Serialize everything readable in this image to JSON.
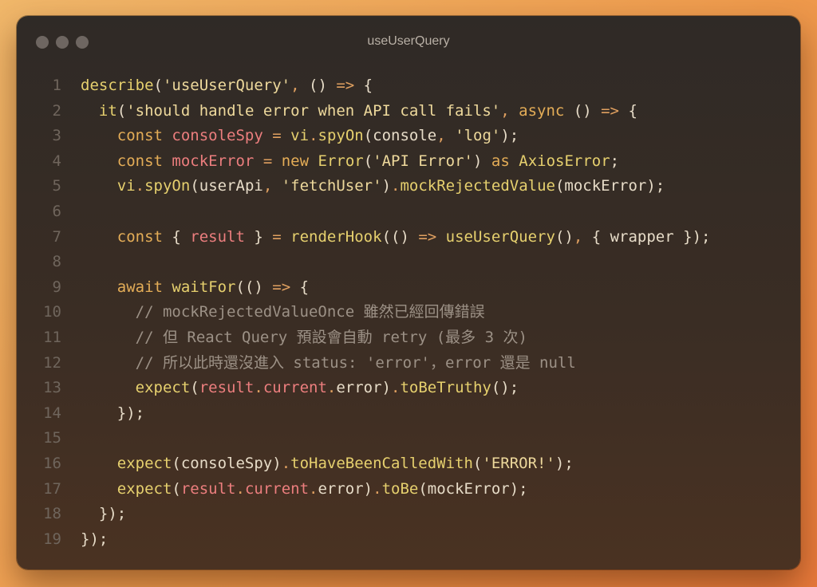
{
  "window": {
    "title": "useUserQuery"
  },
  "colors": {
    "keyword": "#e4ad57",
    "function": "#e6d06e",
    "string": "#eed99c",
    "variable": "#ec7e7e",
    "comment": "#9c9186",
    "plain": "#e7dcc8",
    "line_number": "#6f655c"
  },
  "code": {
    "lines": [
      {
        "n": "1",
        "tokens": [
          {
            "t": "fn",
            "v": "describe"
          },
          {
            "t": "pl",
            "v": "("
          },
          {
            "t": "str",
            "v": "'useUserQuery'"
          },
          {
            "t": "op",
            "v": ","
          },
          {
            "t": "pl",
            "v": " () "
          },
          {
            "t": "op",
            "v": "=>"
          },
          {
            "t": "pl",
            "v": " {"
          }
        ]
      },
      {
        "n": "2",
        "tokens": [
          {
            "t": "pl",
            "v": "  "
          },
          {
            "t": "fn",
            "v": "it"
          },
          {
            "t": "pl",
            "v": "("
          },
          {
            "t": "str",
            "v": "'should handle error when API call fails'"
          },
          {
            "t": "op",
            "v": ","
          },
          {
            "t": "pl",
            "v": " "
          },
          {
            "t": "kw",
            "v": "async"
          },
          {
            "t": "pl",
            "v": " () "
          },
          {
            "t": "op",
            "v": "=>"
          },
          {
            "t": "pl",
            "v": " {"
          }
        ]
      },
      {
        "n": "3",
        "tokens": [
          {
            "t": "pl",
            "v": "    "
          },
          {
            "t": "kw",
            "v": "const"
          },
          {
            "t": "pl",
            "v": " "
          },
          {
            "t": "var",
            "v": "consoleSpy"
          },
          {
            "t": "pl",
            "v": " "
          },
          {
            "t": "op",
            "v": "="
          },
          {
            "t": "pl",
            "v": " "
          },
          {
            "t": "fn",
            "v": "vi"
          },
          {
            "t": "op",
            "v": "."
          },
          {
            "t": "fn",
            "v": "spyOn"
          },
          {
            "t": "pl",
            "v": "(console"
          },
          {
            "t": "op",
            "v": ","
          },
          {
            "t": "pl",
            "v": " "
          },
          {
            "t": "str",
            "v": "'log'"
          },
          {
            "t": "pl",
            "v": ");"
          }
        ]
      },
      {
        "n": "4",
        "tokens": [
          {
            "t": "pl",
            "v": "    "
          },
          {
            "t": "kw",
            "v": "const"
          },
          {
            "t": "pl",
            "v": " "
          },
          {
            "t": "var",
            "v": "mockError"
          },
          {
            "t": "pl",
            "v": " "
          },
          {
            "t": "op",
            "v": "="
          },
          {
            "t": "pl",
            "v": " "
          },
          {
            "t": "kw",
            "v": "new"
          },
          {
            "t": "pl",
            "v": " "
          },
          {
            "t": "fn",
            "v": "Error"
          },
          {
            "t": "pl",
            "v": "("
          },
          {
            "t": "str",
            "v": "'API Error'"
          },
          {
            "t": "pl",
            "v": ") "
          },
          {
            "t": "kw",
            "v": "as"
          },
          {
            "t": "pl",
            "v": " "
          },
          {
            "t": "fn",
            "v": "AxiosError"
          },
          {
            "t": "pl",
            "v": ";"
          }
        ]
      },
      {
        "n": "5",
        "tokens": [
          {
            "t": "pl",
            "v": "    "
          },
          {
            "t": "fn",
            "v": "vi"
          },
          {
            "t": "op",
            "v": "."
          },
          {
            "t": "fn",
            "v": "spyOn"
          },
          {
            "t": "pl",
            "v": "(userApi"
          },
          {
            "t": "op",
            "v": ","
          },
          {
            "t": "pl",
            "v": " "
          },
          {
            "t": "str",
            "v": "'fetchUser'"
          },
          {
            "t": "pl",
            "v": ")"
          },
          {
            "t": "op",
            "v": "."
          },
          {
            "t": "fn",
            "v": "mockRejectedValue"
          },
          {
            "t": "pl",
            "v": "(mockError);"
          }
        ]
      },
      {
        "n": "6",
        "tokens": []
      },
      {
        "n": "7",
        "tokens": [
          {
            "t": "pl",
            "v": "    "
          },
          {
            "t": "kw",
            "v": "const"
          },
          {
            "t": "pl",
            "v": " { "
          },
          {
            "t": "var",
            "v": "result"
          },
          {
            "t": "pl",
            "v": " } "
          },
          {
            "t": "op",
            "v": "="
          },
          {
            "t": "pl",
            "v": " "
          },
          {
            "t": "fn",
            "v": "renderHook"
          },
          {
            "t": "pl",
            "v": "(() "
          },
          {
            "t": "op",
            "v": "=>"
          },
          {
            "t": "pl",
            "v": " "
          },
          {
            "t": "fn",
            "v": "useUserQuery"
          },
          {
            "t": "pl",
            "v": "()"
          },
          {
            "t": "op",
            "v": ","
          },
          {
            "t": "pl",
            "v": " { wrapper });"
          }
        ]
      },
      {
        "n": "8",
        "tokens": []
      },
      {
        "n": "9",
        "tokens": [
          {
            "t": "pl",
            "v": "    "
          },
          {
            "t": "kw",
            "v": "await"
          },
          {
            "t": "pl",
            "v": " "
          },
          {
            "t": "fn",
            "v": "waitFor"
          },
          {
            "t": "pl",
            "v": "(() "
          },
          {
            "t": "op",
            "v": "=>"
          },
          {
            "t": "pl",
            "v": " {"
          }
        ]
      },
      {
        "n": "10",
        "tokens": [
          {
            "t": "pl",
            "v": "      "
          },
          {
            "t": "cm",
            "v": "// mockRejectedValueOnce 雖然已經回傳錯誤"
          }
        ]
      },
      {
        "n": "11",
        "tokens": [
          {
            "t": "pl",
            "v": "      "
          },
          {
            "t": "cm",
            "v": "// 但 React Query 預設會自動 retry (最多 3 次)"
          }
        ]
      },
      {
        "n": "12",
        "tokens": [
          {
            "t": "pl",
            "v": "      "
          },
          {
            "t": "cm",
            "v": "// 所以此時還沒進入 status: 'error'，error 還是 null"
          }
        ]
      },
      {
        "n": "13",
        "tokens": [
          {
            "t": "pl",
            "v": "      "
          },
          {
            "t": "fn",
            "v": "expect"
          },
          {
            "t": "pl",
            "v": "("
          },
          {
            "t": "var",
            "v": "result"
          },
          {
            "t": "op",
            "v": "."
          },
          {
            "t": "var",
            "v": "current"
          },
          {
            "t": "op",
            "v": "."
          },
          {
            "t": "pl",
            "v": "error)"
          },
          {
            "t": "op",
            "v": "."
          },
          {
            "t": "fn",
            "v": "toBeTruthy"
          },
          {
            "t": "pl",
            "v": "();"
          }
        ]
      },
      {
        "n": "14",
        "tokens": [
          {
            "t": "pl",
            "v": "    });"
          }
        ]
      },
      {
        "n": "15",
        "tokens": []
      },
      {
        "n": "16",
        "tokens": [
          {
            "t": "pl",
            "v": "    "
          },
          {
            "t": "fn",
            "v": "expect"
          },
          {
            "t": "pl",
            "v": "(consoleSpy)"
          },
          {
            "t": "op",
            "v": "."
          },
          {
            "t": "fn",
            "v": "toHaveBeenCalledWith"
          },
          {
            "t": "pl",
            "v": "("
          },
          {
            "t": "str",
            "v": "'ERROR!'"
          },
          {
            "t": "pl",
            "v": ");"
          }
        ]
      },
      {
        "n": "17",
        "tokens": [
          {
            "t": "pl",
            "v": "    "
          },
          {
            "t": "fn",
            "v": "expect"
          },
          {
            "t": "pl",
            "v": "("
          },
          {
            "t": "var",
            "v": "result"
          },
          {
            "t": "op",
            "v": "."
          },
          {
            "t": "var",
            "v": "current"
          },
          {
            "t": "op",
            "v": "."
          },
          {
            "t": "pl",
            "v": "error)"
          },
          {
            "t": "op",
            "v": "."
          },
          {
            "t": "fn",
            "v": "toBe"
          },
          {
            "t": "pl",
            "v": "(mockError);"
          }
        ]
      },
      {
        "n": "18",
        "tokens": [
          {
            "t": "pl",
            "v": "  });"
          }
        ]
      },
      {
        "n": "19",
        "tokens": [
          {
            "t": "pl",
            "v": "});"
          }
        ]
      }
    ]
  }
}
